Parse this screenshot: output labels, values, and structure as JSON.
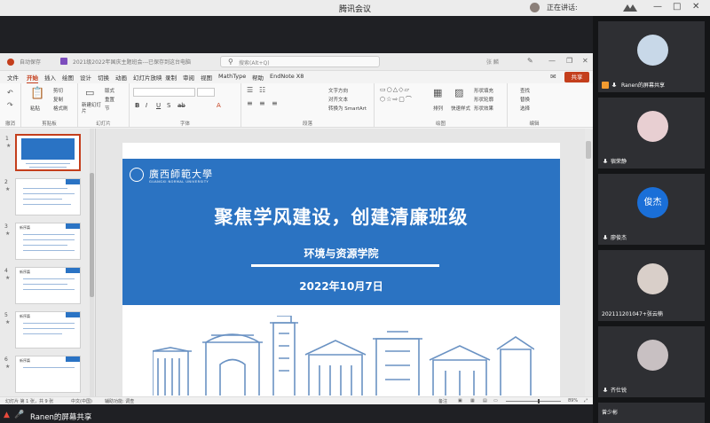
{
  "meeting": {
    "title": "腾讯会议",
    "speaking_label": "正在讲话:",
    "window_controls": [
      "—",
      "□",
      "✕"
    ]
  },
  "ppt": {
    "autosave_label": "自动保存",
    "filename": "2021级2022年国庆主题班会---已保存到这台电脑",
    "search_placeholder": "搜索(Alt+Q)",
    "user_name": "张 麟",
    "menu_tabs": [
      "文件",
      "开始",
      "插入",
      "绘图",
      "设计",
      "切换",
      "动画",
      "幻灯片放映",
      "录制",
      "审阅",
      "视图",
      "MathType",
      "帮助",
      "EndNote X8"
    ],
    "active_tab": "开始",
    "share_label": "共享",
    "ribbon": {
      "groups": [
        "撤消",
        "剪贴板",
        "幻灯片",
        "字体",
        "段落",
        "绘图",
        "编辑"
      ],
      "clipboard": {
        "paste": "粘贴",
        "cut": "剪切",
        "copy": "复制",
        "painter": "格式刷"
      },
      "slides": {
        "new": "新建幻灯片",
        "layout": "版式",
        "reset": "重置",
        "section": "节"
      },
      "paragraph": {
        "text_dir": "文字方向",
        "align_text": "对齐文本",
        "smartart": "转换为 SmartArt"
      },
      "drawing": {
        "arrange": "排列",
        "quick_styles": "快速样式",
        "fill": "形状填充",
        "outline": "形状轮廓",
        "effects": "形状效果"
      },
      "editing": {
        "find": "查找",
        "replace": "替换",
        "select": "选择"
      }
    },
    "thumb_numbers": [
      "1",
      "2",
      "3",
      "4",
      "5",
      "6"
    ],
    "thumb_headers": [
      "",
      "",
      "新序篇",
      "新序篇",
      "新序篇",
      "新序篇"
    ],
    "slide": {
      "univ_cn": "廣西師範大學",
      "univ_en": "GUANGXI NORMAL UNIVERSITY",
      "title": "聚焦学风建设，创建清廉班级",
      "subtitle": "环境与资源学院",
      "date": "2022年10月7日"
    },
    "status": {
      "slide_info": "幻灯片 第 1 张，共 9 张",
      "language": "中文(中国)",
      "accessibility": "辅助功能: 调查",
      "notes": "备注",
      "zoom": "89%"
    }
  },
  "share_bar": {
    "label": "Ranen的屏幕共享"
  },
  "participants": [
    {
      "name": "Ranen的屏幕共享",
      "type": "photo",
      "color": "#c8d8e8",
      "share": true
    },
    {
      "name": "宿荣静",
      "type": "photo",
      "color": "#e8cfd2"
    },
    {
      "name": "廖俊杰",
      "type": "initials",
      "initials": "俊杰"
    },
    {
      "name": "202111201047+张云楠",
      "type": "photo",
      "color": "#d9cfc9"
    },
    {
      "name": "齐仕锐",
      "type": "photo",
      "color": "#c8c0c2"
    },
    {
      "name": "曾少彬",
      "type": "photo",
      "color": "#d8c8cc"
    }
  ]
}
